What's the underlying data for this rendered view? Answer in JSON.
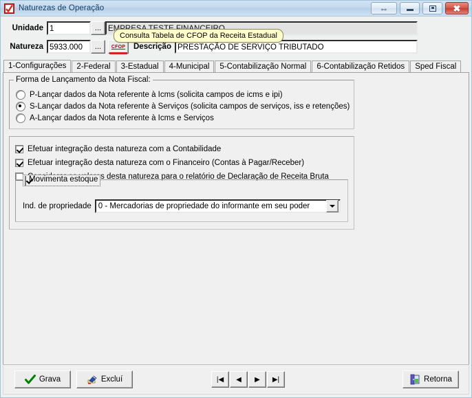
{
  "window": {
    "title": "Naturezas de Operação",
    "icon": "app-checkmark-icon",
    "buttons": {
      "resize": "⇔",
      "minimize": "minimize-icon",
      "maximize": "maximize-icon",
      "close": "✖"
    }
  },
  "header": {
    "unidade_label": "Unidade",
    "unidade_value": "1",
    "unidade_ellipsis": "...",
    "unidade_name": "EMPRESA TESTE FINANCEIRO",
    "natureza_label": "Natureza",
    "natureza_value": "5933.000",
    "natureza_ellipsis": "...",
    "cfop_button": "CFOP",
    "descricao_label": "Descrição",
    "descricao_value": "PRESTAÇÃO DE SERVIÇO TRIBUTADO"
  },
  "tooltip": {
    "text": "Consulta Tabela de CFOP da Receita Estadual",
    "bg": "#ffffcc",
    "border": "#8a8a5c"
  },
  "tabs": [
    {
      "label": "1-Configurações",
      "accel": "1",
      "active": true
    },
    {
      "label": "2-Federal",
      "accel": "2",
      "active": false
    },
    {
      "label": "3-Estadual",
      "accel": "3",
      "active": false
    },
    {
      "label": "4-Municipal",
      "accel": "4",
      "active": false
    },
    {
      "label": "5-Contabilização Normal",
      "accel": "5",
      "active": false
    },
    {
      "label": "6-Contabilização Retidos",
      "accel": "6",
      "active": false
    },
    {
      "label": "Sped Fiscal",
      "accel": "",
      "active": false
    }
  ],
  "forma_group": {
    "title": "Forma de Lançamento da Nota Fiscal:",
    "options": [
      {
        "label": "P-Lançar dados da Nota referente à Icms (solicita campos de icms e ipi)",
        "checked": false
      },
      {
        "label": "S-Lançar dados da Nota referente à Serviços (solicita campos de serviços, iss e retenções)",
        "checked": true
      },
      {
        "label": "A-Lançar dados da Nota referente à Icms e Serviços",
        "checked": false
      }
    ]
  },
  "options_group": {
    "checks": [
      {
        "label": "Efetuar integração desta natureza com a Contabilidade",
        "checked": true
      },
      {
        "label": "Efetuar integração desta natureza com o Financeiro (Contas à Pagar/Receber)",
        "checked": true
      },
      {
        "label": "Considerar os valores desta natureza para o relatório de Declaração de Receita Bruta",
        "checked": false
      }
    ],
    "estoque": {
      "title": "Movimenta estoque",
      "checked": true,
      "prop_label": "Ind. de propriedade",
      "prop_value": "0 - Mercadorias de propriedade do informante em seu poder"
    }
  },
  "bottombar": {
    "grava": "Grava",
    "grava_icon": "check-icon",
    "exclui": "Excluí",
    "exclui_icon": "eraser-icon",
    "retorna": "Retorna",
    "retorna_icon": "door-icon",
    "nav": [
      {
        "label": "|◀",
        "name": "nav-first"
      },
      {
        "label": "◀",
        "name": "nav-prev"
      },
      {
        "label": "▶",
        "name": "nav-next"
      },
      {
        "label": "▶|",
        "name": "nav-last"
      }
    ]
  }
}
